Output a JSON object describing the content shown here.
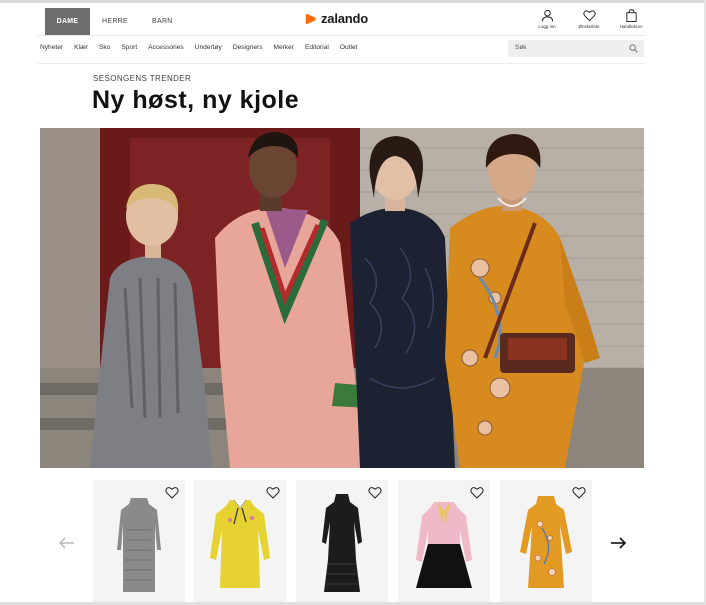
{
  "header": {
    "gender_tabs": [
      {
        "label": "DAME",
        "active": true
      },
      {
        "label": "HERRE",
        "active": false
      },
      {
        "label": "BARN",
        "active": false
      }
    ],
    "logo_text": "zalando",
    "brand_color": "#ff6900",
    "actions": [
      {
        "label": "Logg inn",
        "icon": "user-icon"
      },
      {
        "label": "Ønskeliste",
        "icon": "heart-icon"
      },
      {
        "label": "Handlekurv",
        "icon": "shopping-bag-icon"
      }
    ]
  },
  "nav": {
    "items": [
      "Nyheter",
      "Klær",
      "Sko",
      "Sport",
      "Accessories",
      "Undertøy",
      "Designers",
      "Merker",
      "Editorial",
      "Outlet"
    ],
    "search_placeholder": "Søk"
  },
  "hero": {
    "kicker": "SESONGENS TRENDER",
    "title": "Ny høst, ny kjole"
  },
  "carousel": {
    "products": [
      {
        "name": "grey-knit-dress",
        "color": "#8a8a8a"
      },
      {
        "name": "yellow-dress",
        "color": "#e6d230"
      },
      {
        "name": "black-lace-dress",
        "color": "#1c1c1c"
      },
      {
        "name": "pink-black-dress",
        "color": "#f1b8c8"
      },
      {
        "name": "orange-embroidered-dress",
        "color": "#e39a22"
      }
    ]
  }
}
